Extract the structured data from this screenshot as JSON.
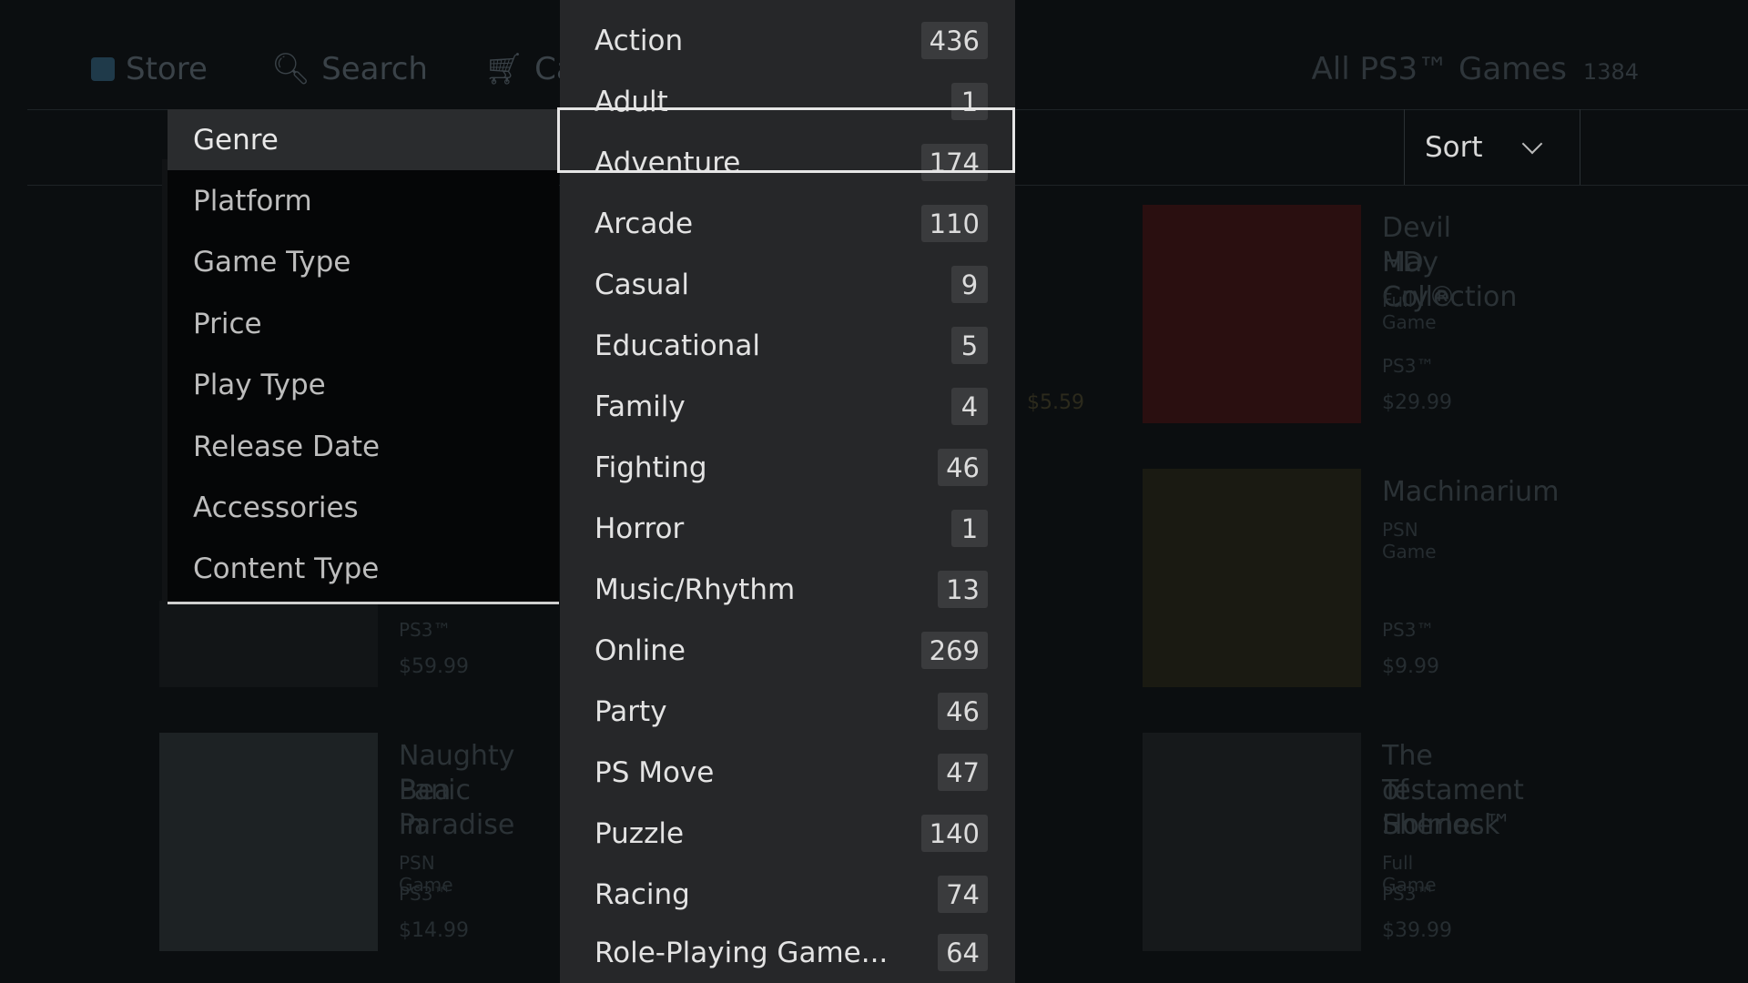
{
  "top_nav": {
    "store": "Store",
    "search": "Search",
    "cart": "Ca",
    "collection_title": "All PS3™ Games",
    "collection_count": "1384"
  },
  "sort": {
    "label": "Sort"
  },
  "categories": [
    {
      "label": "Genre"
    },
    {
      "label": "Platform"
    },
    {
      "label": "Game Type"
    },
    {
      "label": "Price"
    },
    {
      "label": "Play Type"
    },
    {
      "label": "Release Date"
    },
    {
      "label": "Accessories"
    },
    {
      "label": "Content Type"
    }
  ],
  "genres": [
    {
      "name": "Action",
      "count": "436"
    },
    {
      "name": "Adult",
      "count": "1"
    },
    {
      "name": "Adventure",
      "count": "174"
    },
    {
      "name": "Arcade",
      "count": "110"
    },
    {
      "name": "Casual",
      "count": "9"
    },
    {
      "name": "Educational",
      "count": "5"
    },
    {
      "name": "Family",
      "count": "4"
    },
    {
      "name": "Fighting",
      "count": "46"
    },
    {
      "name": "Horror",
      "count": "1"
    },
    {
      "name": "Music/Rhythm",
      "count": "13"
    },
    {
      "name": "Online",
      "count": "269"
    },
    {
      "name": "Party",
      "count": "46"
    },
    {
      "name": "PS Move",
      "count": "47"
    },
    {
      "name": "Puzzle",
      "count": "140"
    },
    {
      "name": "Racing",
      "count": "74"
    },
    {
      "name": "Role-Playing Game...",
      "count": "64"
    }
  ],
  "background_tiles": [
    {
      "title_lines": [
        "Devil May Cry®",
        "HD Collection"
      ],
      "subtitle": "Full Game",
      "platform": "PS3™",
      "price": "$29.99"
    },
    {
      "title_lines": [
        "Machinarium"
      ],
      "subtitle": "PSN Game",
      "platform": "PS3™",
      "price": "$9.99"
    },
    {
      "title_lines": [
        "The Testament",
        "of Sherlock",
        "Holmes™"
      ],
      "subtitle": "Full Game",
      "platform": "PS3™",
      "price": "$39.99"
    },
    {
      "title_lines": [
        "Naughty Bea",
        "Panic in",
        "Paradise"
      ],
      "subtitle": "PSN Game",
      "platform": "PS3™",
      "price": "$14.99"
    },
    {
      "title_lines": [],
      "subtitle": "",
      "platform": "PS3™",
      "price": "$59.99"
    },
    {
      "title_lines": [],
      "subtitle": "",
      "platform": "",
      "price": "$5.59"
    }
  ]
}
